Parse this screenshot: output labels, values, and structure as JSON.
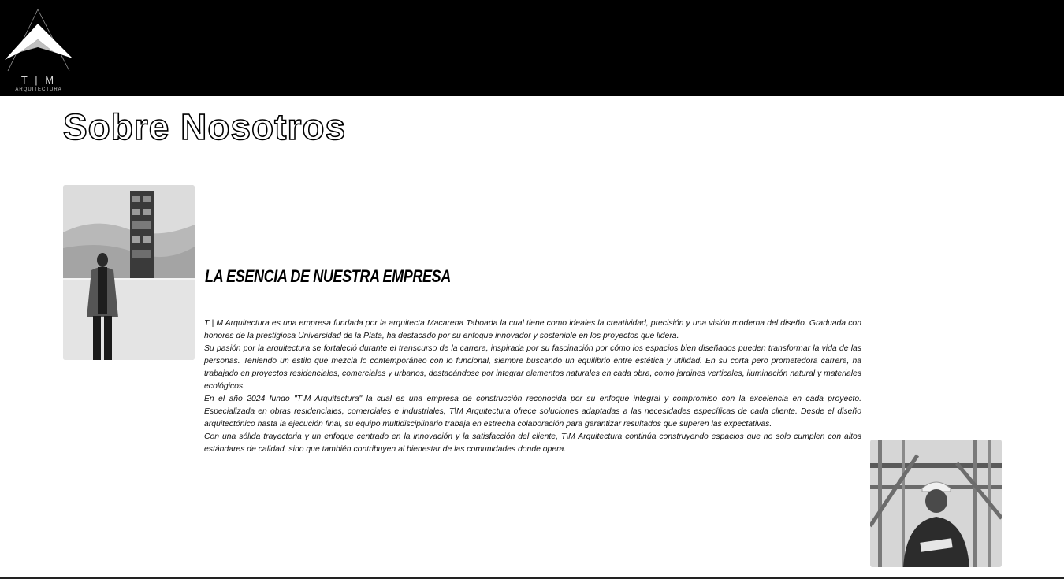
{
  "header": {
    "logo_letters": "T | M",
    "logo_subtitle": "ARQUITECTURA"
  },
  "page_title": "Sobre Nosotros",
  "section": {
    "heading": "LA ESENCIA DE NUESTRA EMPRESA",
    "paragraphs": [
      "T | M Arquitectura es una empresa fundada por la arquitecta Macarena Taboada la cual tiene como ideales la creatividad, precisión y una visión moderna del diseño. Graduada con honores de la prestigiosa Universidad de la Plata, ha destacado por su enfoque innovador y sostenible en los proyectos que lidera.",
      "Su pasión por la arquitectura se fortaleció durante el transcurso de la carrera, inspirada por su fascinación por cómo los espacios bien diseñados pueden transformar la vida de las personas. Teniendo un estilo que mezcla lo contemporáneo con lo funcional, siempre buscando un equilibrio entre estética y utilidad. En su corta pero prometedora carrera, ha trabajado en proyectos residenciales, comerciales y urbanos, destacándose por integrar elementos naturales en cada obra, como jardines verticales, iluminación natural y materiales ecológicos.",
      "En el año 2024 fundo \"T\\M Arquitectura\" la cual es una empresa de construcción reconocida por su enfoque integral y compromiso con la excelencia en cada proyecto. Especializada en obras residenciales, comerciales e industriales, T\\M Arquitectura ofrece soluciones adaptadas a las necesidades específicas de cada cliente. Desde el diseño arquitectónico hasta la ejecución final, su equipo multidisciplinario trabaja en estrecha colaboración para garantizar resultados que superen las expectativas.",
      "Con una sólida trayectoria y un enfoque centrado en la innovación y la satisfacción del cliente, T\\M Arquitectura continúa construyendo espacios que no solo cumplen con altos estándares de calidad, sino que también contribuyen al bienestar de las comunidades donde opera."
    ]
  },
  "images": {
    "founder_photo": "photo-founder-with-building-rendering",
    "worker_photo": "photo-worker-with-hard-hat"
  }
}
